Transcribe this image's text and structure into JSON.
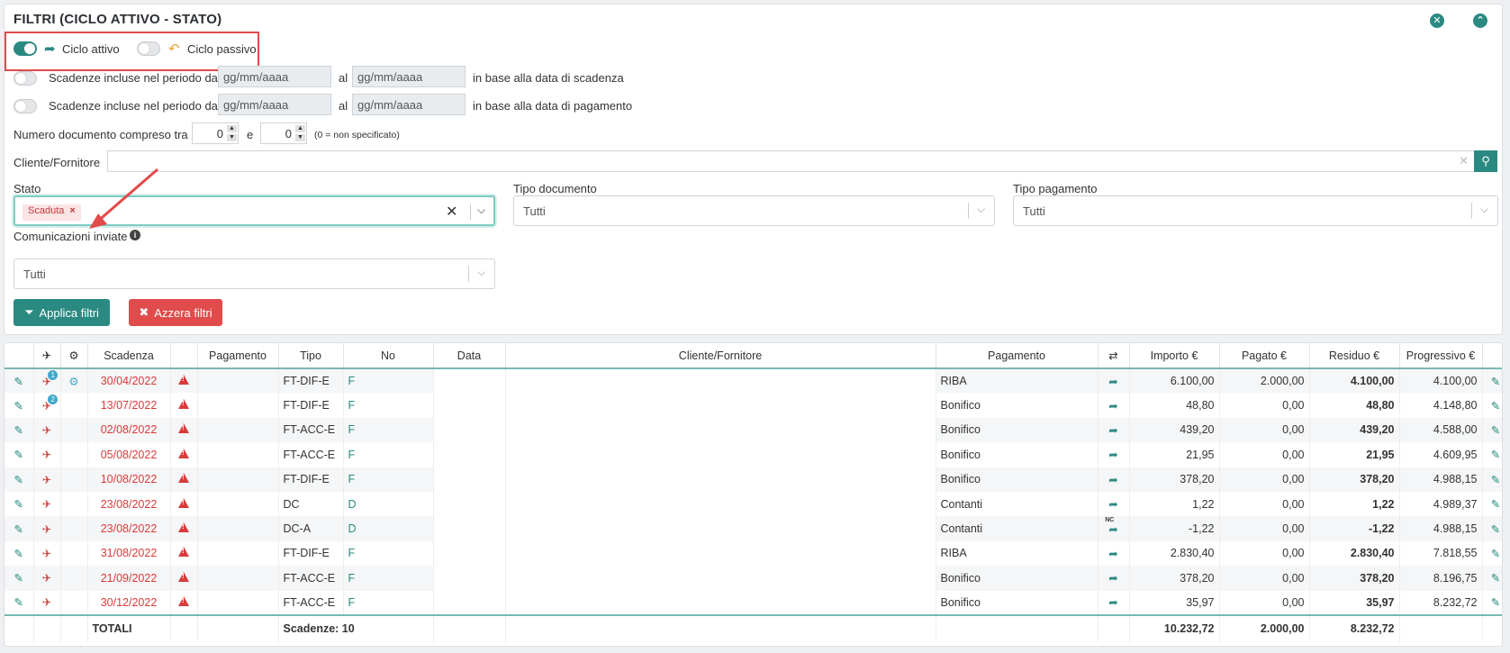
{
  "filters": {
    "title": "FILTRI (CICLO ATTIVO - STATO)",
    "ciclo_attivo": "Ciclo attivo",
    "ciclo_passivo": "Ciclo passivo",
    "row_scadenza": {
      "label": "Scadenze incluse nel periodo dal",
      "al": "al",
      "from_placeholder": "gg/mm/aaaa",
      "to_placeholder": "gg/mm/aaaa",
      "suffix": "in base alla data di scadenza"
    },
    "row_pagamento": {
      "label": "Scadenze incluse nel periodo dal",
      "al": "al",
      "from_placeholder": "gg/mm/aaaa",
      "to_placeholder": "gg/mm/aaaa",
      "suffix": "in base alla data di pagamento"
    },
    "numero": {
      "label": "Numero documento compreso tra",
      "from": "0",
      "e": "e",
      "to": "0",
      "hint": "(0 = non specificato)"
    },
    "cliente_label": "Cliente/Fornitore",
    "stato": {
      "label": "Stato",
      "tag": "Scaduta"
    },
    "tipo_documento": {
      "label": "Tipo documento",
      "value": "Tutti"
    },
    "tipo_pagamento": {
      "label": "Tipo pagamento",
      "value": "Tutti"
    },
    "comunicazioni": {
      "label": "Comunicazioni inviate",
      "value": "Tutti"
    },
    "applica": "Applica filtri",
    "azzera": "Azzera filtri"
  },
  "table": {
    "headers": {
      "scadenza": "Scadenza",
      "pagamento_desc": "Pagamento",
      "tipo": "Tipo",
      "no": "No",
      "data": "Data",
      "cliente": "Cliente/Fornitore",
      "pagamento": "Pagamento",
      "importo": "Importo €",
      "pagato": "Pagato €",
      "residuo": "Residuo €",
      "progressivo": "Progressivo €"
    },
    "rows": [
      {
        "badge": "1",
        "gear": true,
        "scadenza": "30/04/2022",
        "tipo": "FT-DIF-E",
        "no": "F",
        "pagamento": "RIBA",
        "nc": "",
        "importo": "6.100,00",
        "pagato": "2.000,00",
        "residuo": "4.100,00",
        "progressivo": "4.100,00"
      },
      {
        "badge": "2",
        "gear": false,
        "scadenza": "13/07/2022",
        "tipo": "FT-DIF-E",
        "no": "F",
        "pagamento": "Bonifico",
        "nc": "",
        "importo": "48,80",
        "pagato": "0,00",
        "residuo": "48,80",
        "progressivo": "4.148,80"
      },
      {
        "badge": "",
        "gear": false,
        "scadenza": "02/08/2022",
        "tipo": "FT-ACC-E",
        "no": "F",
        "pagamento": "Bonifico",
        "nc": "",
        "importo": "439,20",
        "pagato": "0,00",
        "residuo": "439,20",
        "progressivo": "4.588,00"
      },
      {
        "badge": "",
        "gear": false,
        "scadenza": "05/08/2022",
        "tipo": "FT-ACC-E",
        "no": "F",
        "pagamento": "Bonifico",
        "nc": "",
        "importo": "21,95",
        "pagato": "0,00",
        "residuo": "21,95",
        "progressivo": "4.609,95"
      },
      {
        "badge": "",
        "gear": false,
        "scadenza": "10/08/2022",
        "tipo": "FT-DIF-E",
        "no": "F",
        "pagamento": "Bonifico",
        "nc": "",
        "importo": "378,20",
        "pagato": "0,00",
        "residuo": "378,20",
        "progressivo": "4.988,15"
      },
      {
        "badge": "",
        "gear": false,
        "scadenza": "23/08/2022",
        "tipo": "DC",
        "no": "D",
        "pagamento": "Contanti",
        "nc": "",
        "importo": "1,22",
        "pagato": "0,00",
        "residuo": "1,22",
        "progressivo": "4.989,37"
      },
      {
        "badge": "",
        "gear": false,
        "scadenza": "23/08/2022",
        "tipo": "DC-A",
        "no": "D",
        "pagamento": "Contanti",
        "nc": "NC",
        "importo": "-1,22",
        "pagato": "0,00",
        "residuo": "-1,22",
        "progressivo": "4.988,15"
      },
      {
        "badge": "",
        "gear": false,
        "scadenza": "31/08/2022",
        "tipo": "FT-DIF-E",
        "no": "F",
        "pagamento": "RIBA",
        "nc": "",
        "importo": "2.830,40",
        "pagato": "0,00",
        "residuo": "2.830,40",
        "progressivo": "7.818,55"
      },
      {
        "badge": "",
        "gear": false,
        "scadenza": "21/09/2022",
        "tipo": "FT-ACC-E",
        "no": "F",
        "pagamento": "Bonifico",
        "nc": "",
        "importo": "378,20",
        "pagato": "0,00",
        "residuo": "378,20",
        "progressivo": "8.196,75"
      },
      {
        "badge": "",
        "gear": false,
        "scadenza": "30/12/2022",
        "tipo": "FT-ACC-E",
        "no": "F",
        "pagamento": "Bonifico",
        "nc": "",
        "importo": "35,97",
        "pagato": "0,00",
        "residuo": "35,97",
        "progressivo": "8.232,72"
      }
    ],
    "totals": {
      "label": "TOTALI",
      "scadenze": "Scadenze: 10",
      "importo": "10.232,72",
      "pagato": "2.000,00",
      "residuo": "8.232,72"
    }
  },
  "colors": {
    "teal": "#2a8a82",
    "danger": "#d83b3b",
    "highlight": "#e34a4a"
  },
  "icons": [
    "close-circle-icon",
    "collapse-icon",
    "share-icon",
    "reply-icon",
    "search-icon",
    "info-icon",
    "filter-icon",
    "times-icon",
    "plane-icon",
    "gear-icon",
    "edit-icon",
    "warning-icon",
    "exchange-icon"
  ]
}
